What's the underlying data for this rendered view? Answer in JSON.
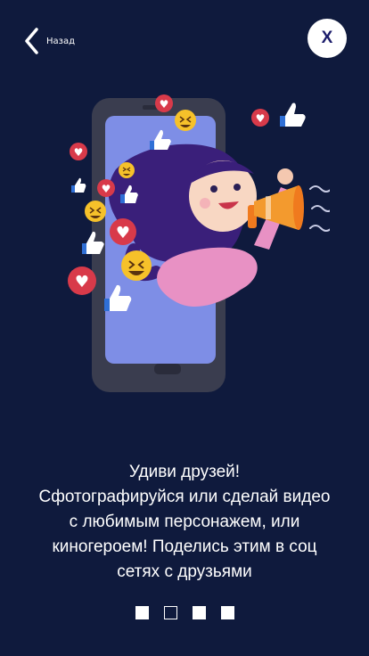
{
  "header": {
    "back_label": "Назад",
    "close_label": "X"
  },
  "slide": {
    "illustration_icon": "influencer-megaphone-illustration",
    "caption_lines": [
      "Удиви друзей!",
      "Сфотографируйся или сделай видео",
      "с любимым персонажем, или",
      "киногероем! Поделись этим в соц",
      "сетях с друзьями"
    ]
  },
  "pagination": {
    "total": 4,
    "current": 2
  },
  "colors": {
    "background": "#0f1a3d",
    "accent": "#1b1c6b",
    "phone_screen": "#7e8ee6",
    "hair": "#3a1f7a",
    "heart": "#d83a4a",
    "like": "#2f6fd6",
    "emoji": "#f6c12a",
    "megaphone": "#f07a1e"
  }
}
